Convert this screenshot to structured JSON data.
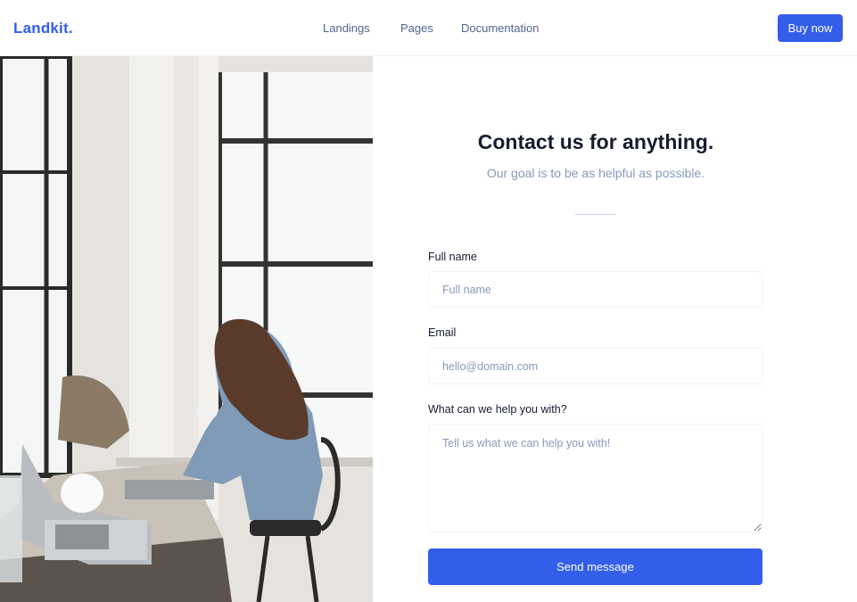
{
  "nav": {
    "brand": "Landkit.",
    "links": [
      "Landings",
      "Pages",
      "Documentation"
    ],
    "cta": "Buy now"
  },
  "hero_image": {
    "subject": "woman-with-coffee-cup-at-laptop-by-window"
  },
  "contact": {
    "title": "Contact us for anything.",
    "subtitle": "Our goal is to be as helpful as possible.",
    "fields": [
      {
        "label": "Full name",
        "placeholder": "Full name"
      },
      {
        "label": "Email",
        "placeholder": "hello@domain.com"
      },
      {
        "label": "What can we help you with?",
        "placeholder": "Tell us what we can help you with!"
      }
    ],
    "submit": "Send message"
  },
  "colors": {
    "accent": "#335eea",
    "muted_text": "#869ab8",
    "nav_text": "#506690"
  }
}
